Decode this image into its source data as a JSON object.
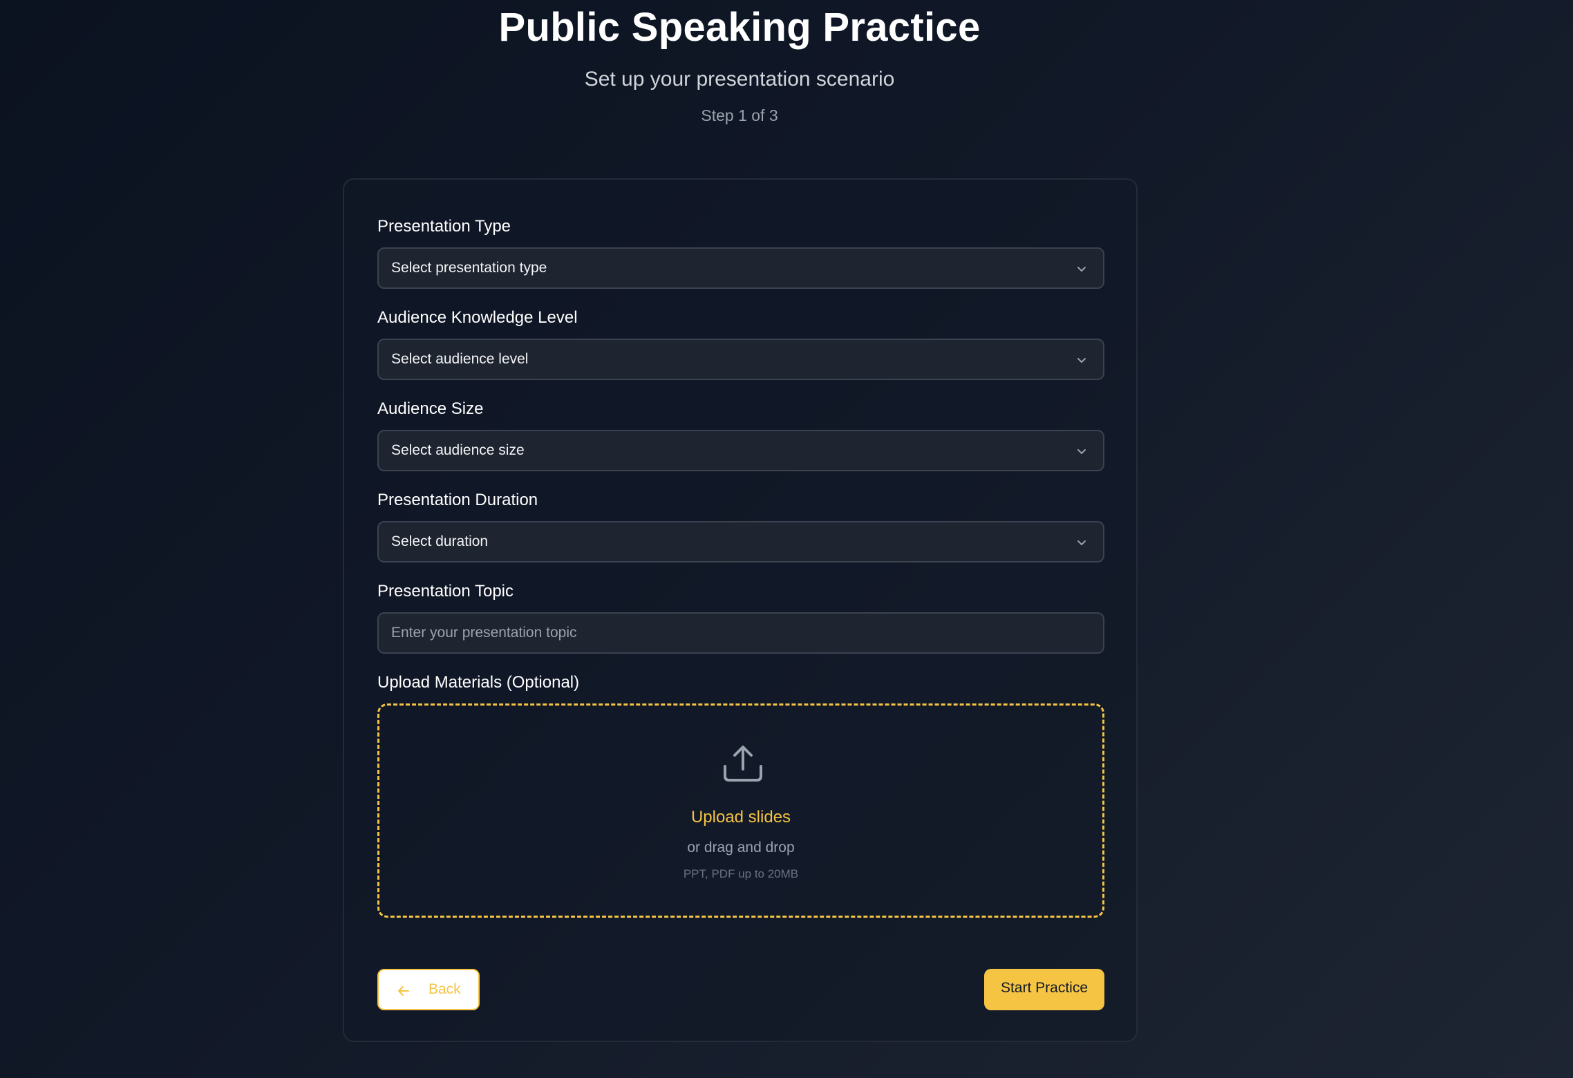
{
  "header": {
    "title": "Public Speaking Practice",
    "subtitle": "Set up your presentation scenario",
    "step": "Step 1 of 3"
  },
  "form": {
    "presentation_type": {
      "label": "Presentation Type",
      "value": "Select presentation type"
    },
    "audience_level": {
      "label": "Audience Knowledge Level",
      "value": "Select audience level"
    },
    "audience_size": {
      "label": "Audience Size",
      "value": "Select audience size"
    },
    "duration": {
      "label": "Presentation Duration",
      "value": "Select duration"
    },
    "topic": {
      "label": "Presentation Topic",
      "value": "",
      "placeholder": "Enter your presentation topic"
    },
    "upload": {
      "label": "Upload Materials (Optional)",
      "link": "Upload slides",
      "drag_text": "or drag and drop",
      "hint": "PPT, PDF up to 20MB"
    }
  },
  "actions": {
    "back_label": "Back",
    "start_label": "Start Practice"
  },
  "icons": {
    "select_chevron": "chevron-down-icon",
    "upload": "upload-icon",
    "back": "arrow-left-icon"
  },
  "colors": {
    "accent": "#f5c443",
    "background": "#111827",
    "field_background": "#1e2430",
    "field_border": "#3b4250"
  }
}
